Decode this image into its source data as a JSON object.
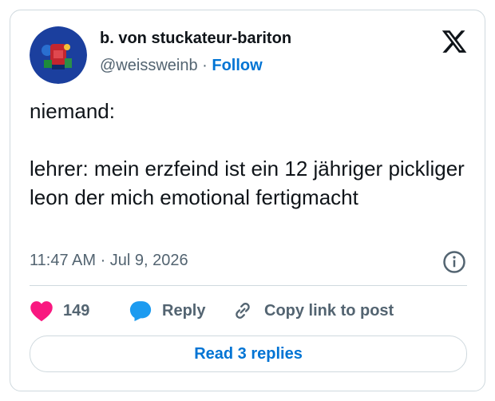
{
  "author": {
    "display_name": "b. von stuckateur-bariton",
    "handle": "@weissweinb",
    "separator": "·",
    "follow_label": "Follow"
  },
  "tweet": {
    "lines": [
      "niemand:",
      "lehrer: mein erzfeind ist ein 12 jähriger pickliger leon der mich emotional fertigmacht"
    ],
    "timestamp": "11:47 AM · Jul 9, 2026"
  },
  "actions": {
    "like_count": "149",
    "reply_label": "Reply",
    "copy_label": "Copy link to post"
  },
  "read_replies_label": "Read 3 replies",
  "icons": {
    "brand": "x-logo-icon",
    "info": "info-icon",
    "like": "heart-icon",
    "reply": "speech-bubble-icon",
    "copy": "link-icon"
  },
  "colors": {
    "heart": "#f91880",
    "reply_bubble": "#1d9bf0",
    "link_blue": "#0074d4",
    "secondary_text": "#536471"
  }
}
